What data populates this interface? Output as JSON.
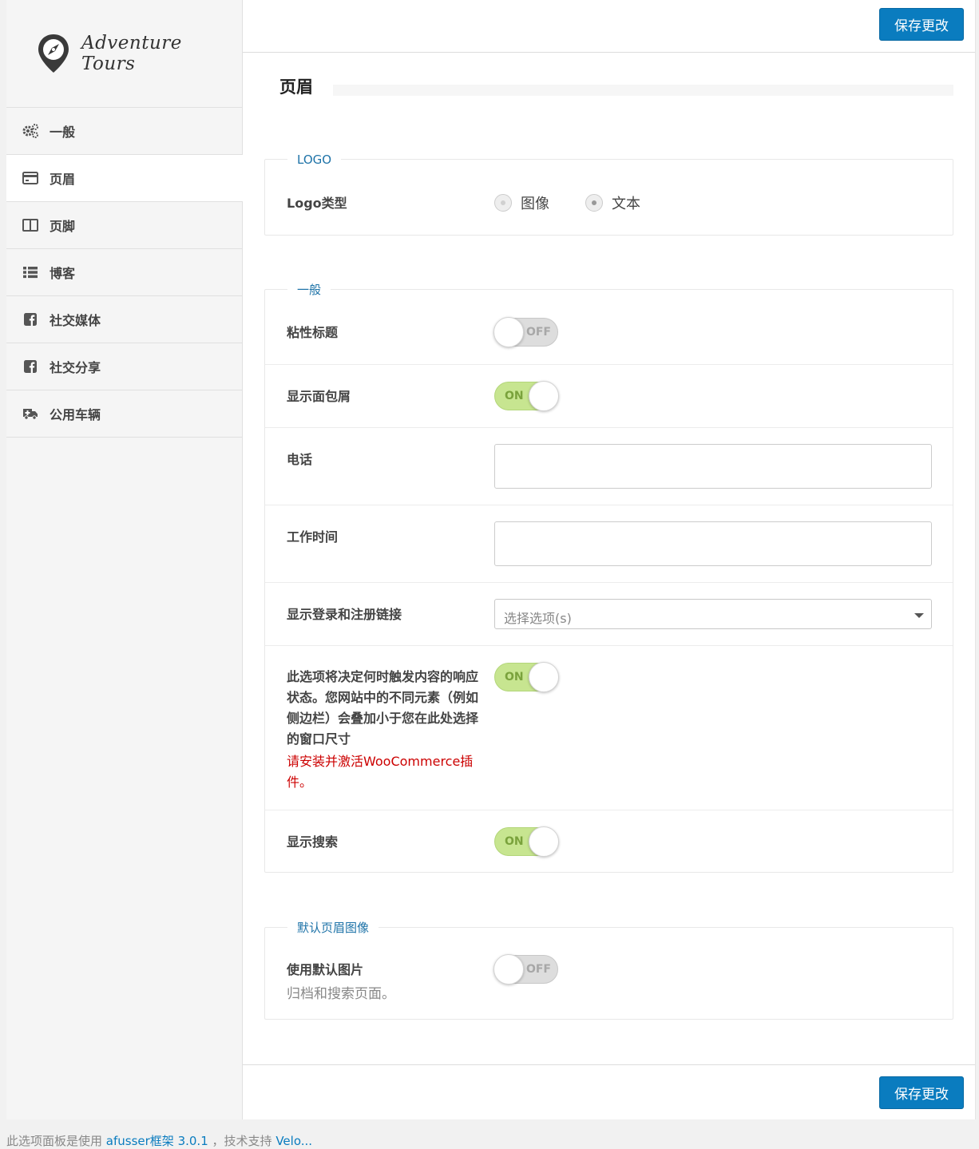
{
  "sidebar": {
    "logo_text": "Adventure Tours",
    "items": [
      {
        "label": "一般",
        "icon": "gears-icon"
      },
      {
        "label": "页眉",
        "icon": "card-icon"
      },
      {
        "label": "页脚",
        "icon": "columns-icon"
      },
      {
        "label": "博客",
        "icon": "list-icon"
      },
      {
        "label": "社交媒体",
        "icon": "facebook-icon"
      },
      {
        "label": "社交分享",
        "icon": "facebook-icon"
      },
      {
        "label": "公用车辆",
        "icon": "ambulance-icon"
      }
    ],
    "active_index": 1
  },
  "toolbar": {
    "save_label": "保存更改"
  },
  "page": {
    "title": "页眉"
  },
  "sections": {
    "logo": {
      "legend": "LOGO",
      "logo_type_label": "Logo类型",
      "options": [
        "图像",
        "文本"
      ],
      "selected": "文本"
    },
    "general": {
      "legend": "一般",
      "sticky_header_label": "粘性标题",
      "sticky_header_state": "OFF",
      "breadcrumbs_label": "显示面包屑",
      "breadcrumbs_state": "ON",
      "phone_label": "电话",
      "phone_value": "",
      "hours_label": "工作时间",
      "hours_value": "",
      "login_links_label": "显示登录和注册链接",
      "login_links_placeholder": "选择选项(s)",
      "responsive_label": "此选项将决定何时触发内容的响应状态。您网站中的不同元素（例如侧边栏）会叠加小于您在此处选择的窗口尺寸",
      "responsive_state": "ON",
      "woocommerce_notice": "请安装并激活WooCommerce插件。",
      "search_label": "显示搜索",
      "search_state": "ON"
    },
    "default_header_image": {
      "legend": "默认页眉图像",
      "use_default_label": "使用默认图片",
      "use_default_desc": "归档和搜索页面。",
      "use_default_state": "OFF"
    }
  },
  "footer": {
    "text_prefix": "此选项面板是使用",
    "link1": "afusser框架 3.0.1",
    "text_middle": "，技术支持",
    "link2": "Velo..."
  },
  "colors": {
    "primary": "#0a7cbf",
    "legend": "#1e73a8",
    "toggle_on": "#c7e590",
    "warning": "#cc0000"
  }
}
